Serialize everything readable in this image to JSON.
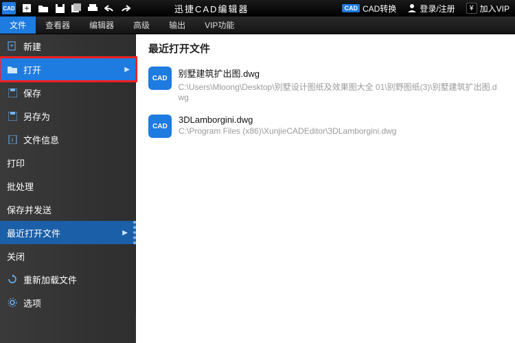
{
  "titlebar": {
    "app_badge": "CAD",
    "app_title": "迅捷CAD编辑器",
    "convert_label": "CAD转换",
    "login_label": "登录/注册",
    "vip_label": "加入VIP"
  },
  "menu": {
    "tabs": [
      "文件",
      "查看器",
      "编辑器",
      "高级",
      "输出",
      "VIP功能"
    ],
    "active_index": 0
  },
  "sidebar": {
    "items": [
      {
        "label": "新建",
        "icon": "new"
      },
      {
        "label": "打开",
        "icon": "open",
        "highlight": true,
        "arrow": true
      },
      {
        "label": "保存",
        "icon": "save"
      },
      {
        "label": "另存为",
        "icon": "saveas"
      },
      {
        "label": "文件信息",
        "icon": "info"
      },
      {
        "label": "打印",
        "icon": ""
      },
      {
        "label": "批处理",
        "icon": ""
      },
      {
        "label": "保存并发送",
        "icon": ""
      },
      {
        "label": "最近打开文件",
        "icon": "",
        "selected": true,
        "arrow": true
      },
      {
        "label": "关闭",
        "icon": ""
      },
      {
        "label": "重新加载文件",
        "icon": "reload"
      },
      {
        "label": "选项",
        "icon": "gear"
      }
    ]
  },
  "content": {
    "heading": "最近打开文件",
    "recent": [
      {
        "name": "别墅建筑扩出图.dwg",
        "path": "C:\\Users\\Mloong\\Desktop\\别墅设计图纸及效果图大全 01\\别野图纸(3)\\别墅建筑扩出图.dwg"
      },
      {
        "name": "3DLamborgini.dwg",
        "path": "C:\\Program Files (x86)\\XunjieCADEditor\\3DLamborgini.dwg"
      }
    ]
  }
}
